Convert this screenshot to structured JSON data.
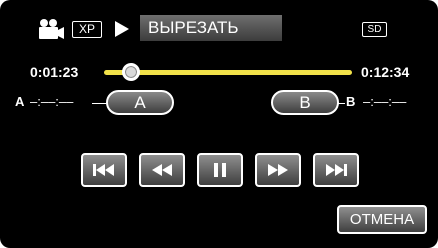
{
  "header": {
    "camera_icon": "movie-camera-icon",
    "quality_badge": "XP",
    "play_icon": "play-icon",
    "title": "ВЫРЕЗАТЬ",
    "media_badge": "SD"
  },
  "timeline": {
    "current_time": "0:01:23",
    "total_time": "0:12:34",
    "progress": 0.11,
    "track_color": "#f2e24a"
  },
  "markers": {
    "a_label": "A",
    "a_time": "–:––:––",
    "a_button": "A",
    "b_button": "B",
    "b_label": "B",
    "b_time": "–:––:––"
  },
  "controls": {
    "icons": [
      "skip-to-start-icon",
      "rewind-icon",
      "pause-icon",
      "fast-forward-icon",
      "skip-to-end-icon"
    ]
  },
  "cancel_label": "ОТМЕНА"
}
